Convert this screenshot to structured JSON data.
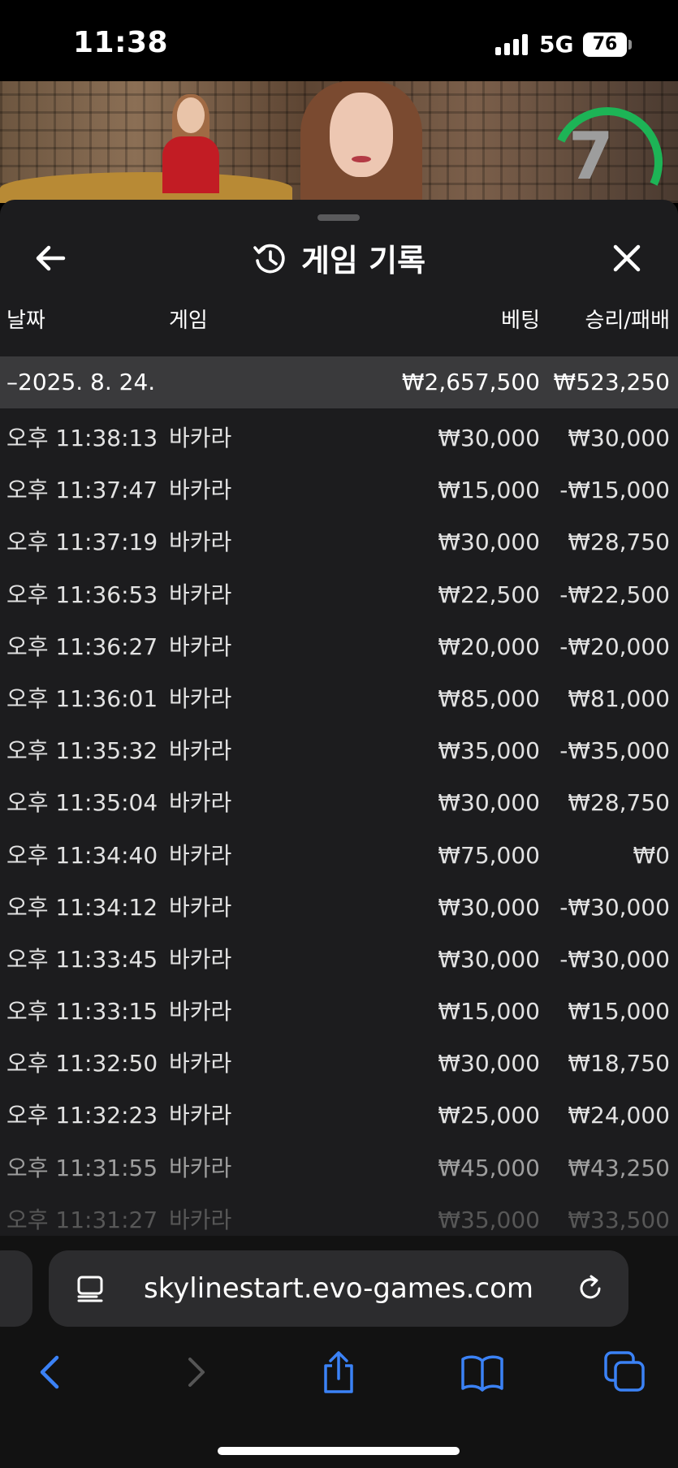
{
  "status_bar": {
    "time": "11:38",
    "network": "5G",
    "battery": "76"
  },
  "video": {
    "timer": "7"
  },
  "panel": {
    "title": "게임 기록"
  },
  "table": {
    "headers": {
      "date": "날짜",
      "game": "게임",
      "bet": "베팅",
      "result": "승리/패배"
    },
    "summary": {
      "date": "–2025. 8. 24.",
      "bet": "₩2,657,500",
      "result": "₩523,250"
    },
    "rows": [
      {
        "time": "오후 11:38:13",
        "game": "바카라",
        "bet": "₩30,000",
        "result": "₩30,000"
      },
      {
        "time": "오후 11:37:47",
        "game": "바카라",
        "bet": "₩15,000",
        "result": "-₩15,000"
      },
      {
        "time": "오후 11:37:19",
        "game": "바카라",
        "bet": "₩30,000",
        "result": "₩28,750"
      },
      {
        "time": "오후 11:36:53",
        "game": "바카라",
        "bet": "₩22,500",
        "result": "-₩22,500"
      },
      {
        "time": "오후 11:36:27",
        "game": "바카라",
        "bet": "₩20,000",
        "result": "-₩20,000"
      },
      {
        "time": "오후 11:36:01",
        "game": "바카라",
        "bet": "₩85,000",
        "result": "₩81,000"
      },
      {
        "time": "오후 11:35:32",
        "game": "바카라",
        "bet": "₩35,000",
        "result": "-₩35,000"
      },
      {
        "time": "오후 11:35:04",
        "game": "바카라",
        "bet": "₩30,000",
        "result": "₩28,750"
      },
      {
        "time": "오후 11:34:40",
        "game": "바카라",
        "bet": "₩75,000",
        "result": "₩0"
      },
      {
        "time": "오후 11:34:12",
        "game": "바카라",
        "bet": "₩30,000",
        "result": "-₩30,000"
      },
      {
        "time": "오후 11:33:45",
        "game": "바카라",
        "bet": "₩30,000",
        "result": "-₩30,000"
      },
      {
        "time": "오후 11:33:15",
        "game": "바카라",
        "bet": "₩15,000",
        "result": "₩15,000"
      },
      {
        "time": "오후 11:32:50",
        "game": "바카라",
        "bet": "₩30,000",
        "result": "₩18,750"
      },
      {
        "time": "오후 11:32:23",
        "game": "바카라",
        "bet": "₩25,000",
        "result": "₩24,000"
      },
      {
        "time": "오후 11:31:55",
        "game": "바카라",
        "bet": "₩45,000",
        "result": "₩43,250"
      },
      {
        "time": "오후 11:31:27",
        "game": "바카라",
        "bet": "₩35,000",
        "result": "₩33,500"
      }
    ]
  },
  "browser": {
    "url": "skylinestart.evo-games.com"
  },
  "colors": {
    "panel_bg": "#1c1c1e",
    "date_row_bg": "#3a3a3c",
    "accent_blue": "#3b82f6",
    "timer_green": "#1db456"
  },
  "icons": {
    "back": "arrow-left-icon",
    "history": "history-icon",
    "close": "close-icon",
    "reader": "reader-icon",
    "reload": "reload-icon",
    "nav_back": "chevron-left-icon",
    "nav_forward": "chevron-right-icon",
    "share": "share-icon",
    "bookmarks": "book-icon",
    "tabs": "tabs-icon"
  }
}
